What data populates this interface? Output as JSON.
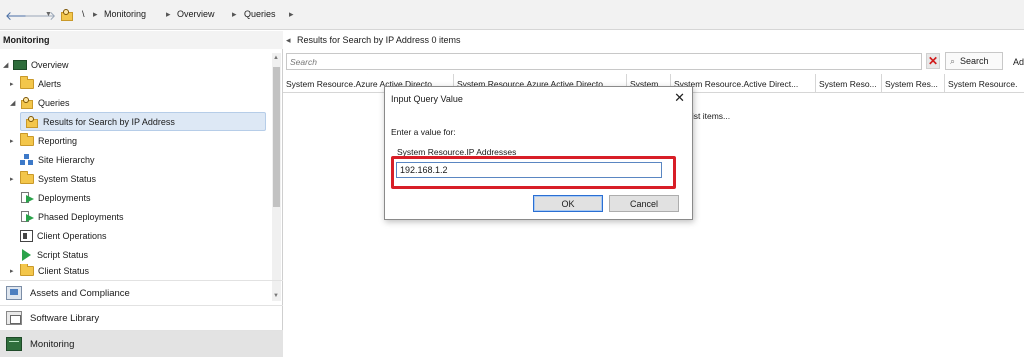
{
  "address_bar": {
    "breadcrumbs": [
      "\\",
      "Monitoring",
      "Overview",
      "Queries"
    ],
    "separator": "▸"
  },
  "left_panel": {
    "title": "Monitoring",
    "tree": [
      {
        "label": "Overview",
        "icon": "overview-icon",
        "expanded": true
      },
      {
        "label": "Alerts",
        "icon": "folder-icon"
      },
      {
        "label": "Queries",
        "icon": "query-folder-icon",
        "expanded": true
      },
      {
        "label": "Results for Search by IP Address",
        "icon": "query-icon",
        "selected": true
      },
      {
        "label": "Reporting",
        "icon": "folder-icon"
      },
      {
        "label": "Site Hierarchy",
        "icon": "site-hierarchy-icon"
      },
      {
        "label": "System Status",
        "icon": "folder-icon"
      },
      {
        "label": "Deployments",
        "icon": "deployment-icon"
      },
      {
        "label": "Phased Deployments",
        "icon": "deployment-icon"
      },
      {
        "label": "Client Operations",
        "icon": "client-operations-icon"
      },
      {
        "label": "Script Status",
        "icon": "script-icon"
      },
      {
        "label": "Client Status",
        "icon": "folder-icon"
      }
    ],
    "workspaces": [
      {
        "label": "Assets and Compliance",
        "icon": "assets-icon"
      },
      {
        "label": "Software Library",
        "icon": "software-library-icon"
      },
      {
        "label": "Monitoring",
        "icon": "monitoring-icon",
        "active": true
      }
    ]
  },
  "results": {
    "title": "Results for Search by IP Address 0 items",
    "search_placeholder": "Search",
    "search_button": "Search",
    "add_criteria": "Ad",
    "columns": [
      "System Resource.Azure Active Directo...",
      "System Resource.Azure Active Directo...",
      "System...",
      "System Resource.Active Direct...",
      "System Reso...",
      "System Res...",
      "System Resource."
    ],
    "empty_message": "list items..."
  },
  "dialog": {
    "title": "Input Query Value",
    "prompt": "Enter a value for:",
    "field_label": "System Resource.IP Addresses",
    "value": "192.168.1.2",
    "ok": "OK",
    "cancel": "Cancel"
  },
  "colors": {
    "highlight": "#d81e27",
    "selection": "#dde8f5",
    "clear_x": "#d11b1b"
  }
}
